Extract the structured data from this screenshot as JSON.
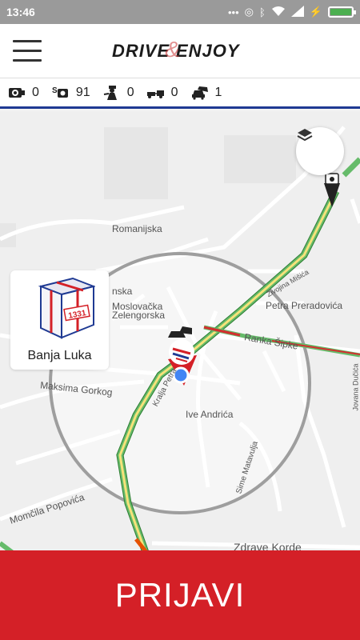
{
  "status_bar": {
    "time": "13:46",
    "indicators": "... ",
    "battery_level": 1.0
  },
  "header": {
    "logo_word1": "DRIVE",
    "logo_amp": "&",
    "logo_word2": "ENJOY"
  },
  "stats": [
    {
      "icon": "speed-camera-icon",
      "value": "0"
    },
    {
      "icon": "radar-icon",
      "value": "91"
    },
    {
      "icon": "police-officer-icon",
      "value": "0"
    },
    {
      "icon": "tow-truck-icon",
      "value": "0"
    },
    {
      "icon": "car-accident-icon",
      "value": "1"
    }
  ],
  "map": {
    "city_label": "Banja Luka",
    "badge_number": "1331",
    "streets": {
      "romanijska": "Romanijska",
      "nska": "nska",
      "moslovacka": "Moslovačka",
      "zelengorska": "Zelengorska",
      "petra_preradovica": "Petra Preradovića",
      "ranka_sipke": "Ranka Šipke",
      "maksima_gorkog": "Maksima Gorkog",
      "kralja_petra": "Kralja Petra",
      "ive_andrica": "Ive Andrića",
      "momcila_popovica": "Momčila Popovića",
      "sime_matavulja": "Sime Matavulja",
      "zdrave_korde": "Zdrave Korde",
      "jovana_ducica": "Jovana Dučića",
      "zivojina_misica": "Živojina Mišića"
    }
  },
  "colors": {
    "accent_red": "#d42027",
    "stats_border": "#1f3a93",
    "traffic_green": "#4caf50",
    "traffic_yellow": "#f6e27a",
    "traffic_red": "#d32f2f"
  },
  "actions": {
    "report_label": "PRIJAVI"
  }
}
